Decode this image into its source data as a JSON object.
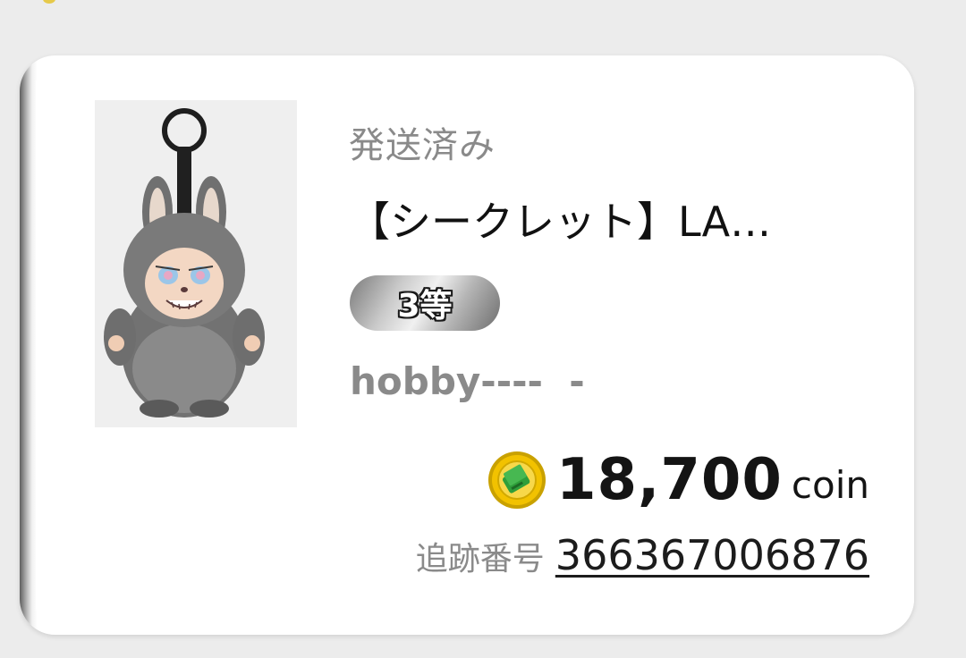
{
  "order": {
    "status": "発送済み",
    "title": "【シークレット】LA…",
    "rank": "3等",
    "seller": "hobby----  -",
    "price": {
      "amount": "18,700",
      "unit": "coin"
    },
    "tracking": {
      "label": "追跡番号",
      "number": "366367006876"
    }
  },
  "colors": {
    "card_bg": "#ffffff",
    "page_bg": "#ececec",
    "muted_text": "#8a8a8a",
    "coin_gold": "#f2c200",
    "coin_green": "#2f9e3a"
  },
  "icons": {
    "product": "labubu-plush-keychain-image",
    "coin": "coin-icon"
  }
}
